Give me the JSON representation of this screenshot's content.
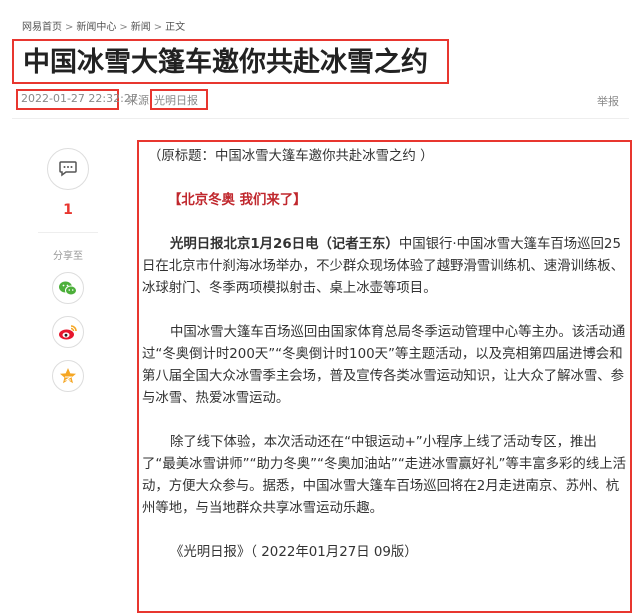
{
  "breadcrumb": [
    "网易首页",
    "新闻中心",
    "新闻",
    "正文"
  ],
  "breadcrumb_sep": ">",
  "article": {
    "title": "中国冰雪大篷车邀你共赴冰雪之约",
    "time": "2022-01-27 22:32:27",
    "source_label": "来源:",
    "source": "光明日报",
    "report_label": "举报"
  },
  "sidebar": {
    "comment_count": "1",
    "share_label": "分享至"
  },
  "content": {
    "original_title": "（原标题：中国冰雪大篷车邀你共赴冰雪之约 ）",
    "subheading": "【北京冬奥 我们来了】",
    "p1_lead": "光明日报北京1月26日电（记者王东）",
    "p1": "中国银行·中国冰雪大篷车百场巡回25日在北京市什刹海冰场举办，不少群众现场体验了越野滑雪训练机、速滑训练板、冰球射门、冬季两项模拟射击、桌上冰壶等项目。",
    "p2": "中国冰雪大篷车百场巡回由国家体育总局冬季运动管理中心等主办。该活动通过“冬奥倒计时200天”“冬奥倒计时100天”等主题活动，以及亮相第四届进博会和第八届全国大众冰雪季主会场，普及宣传各类冰雪运动知识，让大众了解冰雪、参与冰雪、热爱冰雪运动。",
    "p3": "除了线下体验，本次活动还在“中银运动+”小程序上线了活动专区，推出了“最美冰雪讲师”“助力冬奥”“冬奥加油站”“走进冰雪赢好礼”等丰富多彩的线上活动，方便大众参与。据悉，中国冰雪大篷车百场巡回将在2月走进南京、苏州、杭州等地，与当地群众共享冰雪运动乐趣。",
    "footer": "《光明日报》（ 2022年01月27日 09版）"
  },
  "colors": {
    "annotation": "#e8362f",
    "accent_red": "#c0272d",
    "wechat": "#4caf3a",
    "weibo": "#e6162d",
    "qzone": "#f5a623"
  }
}
